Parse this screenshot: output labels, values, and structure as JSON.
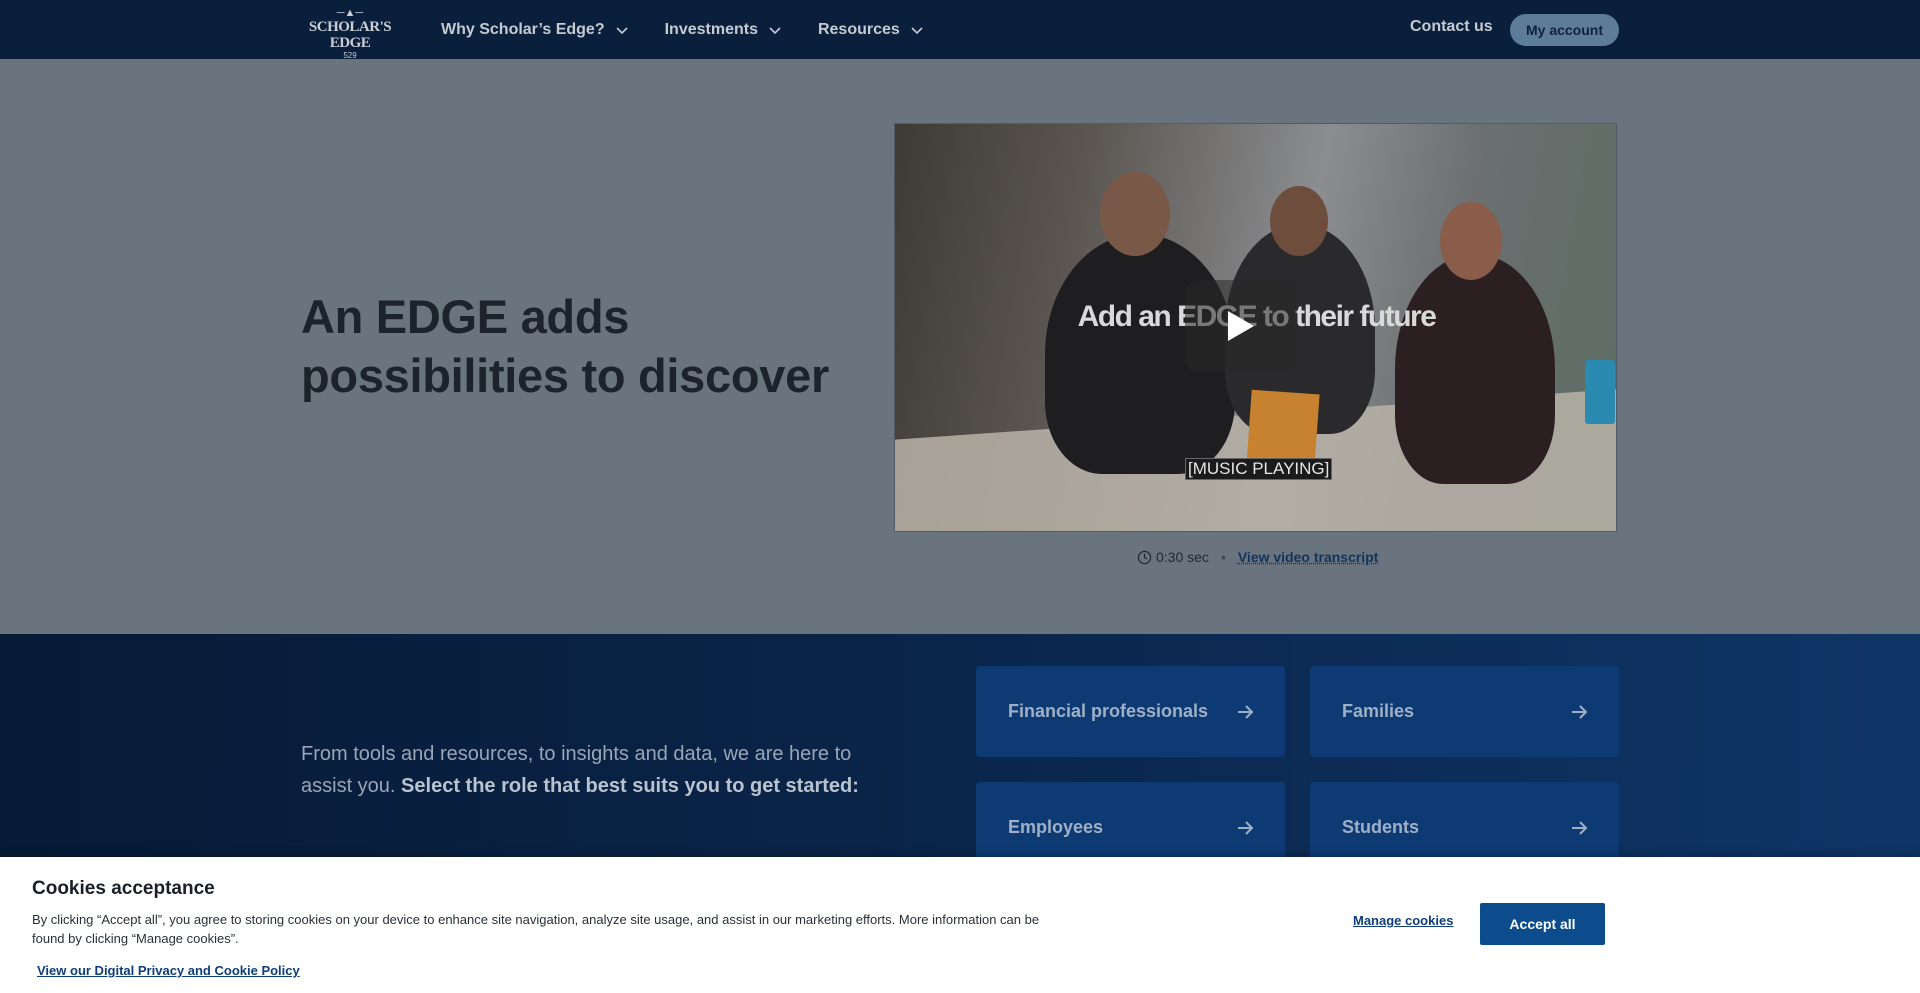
{
  "header": {
    "logo": {
      "top": "— —",
      "name": "SCHOLAR'S EDGE",
      "number": "529"
    },
    "nav": [
      {
        "label": "Why Scholar’s Edge?"
      },
      {
        "label": "Investments"
      },
      {
        "label": "Resources"
      }
    ],
    "contact_label": "Contact us",
    "account_label": "My account"
  },
  "hero": {
    "title": "An EDGE adds possibilities to discover",
    "video": {
      "overlay_title": "Add an EDGE to their future",
      "caption": "[MUSIC PLAYING]",
      "play_icon": "play-icon",
      "duration": "0:30 sec",
      "separator": "•",
      "transcript_label": "View video transcript"
    }
  },
  "roles": {
    "intro": "From tools and resources, to insights and data, we are here to assist you.",
    "intro_bold": "Select the role that best suits you to get started:",
    "cards": [
      {
        "label": "Financial professionals"
      },
      {
        "label": "Families"
      },
      {
        "label": "Employees"
      },
      {
        "label": "Students"
      }
    ]
  },
  "cookie": {
    "title": "Cookies acceptance",
    "body": "By clicking “Accept all”, you agree to storing cookies on your device to enhance site navigation, analyze site usage, and assist in our marketing efforts. More information can be found by clicking “Manage cookies”.",
    "policy_link": "View our Digital Privacy and Cookie Policy",
    "manage_label": "Manage cookies",
    "accept_label": "Accept all"
  },
  "colors": {
    "header_bg": "#0a1f3c",
    "hero_bg": "#6a747e",
    "roles_bg": "#0a2448",
    "card_bg": "#0e3a74",
    "accept_bg": "#0d4c8c",
    "link": "#0f3e7a"
  }
}
